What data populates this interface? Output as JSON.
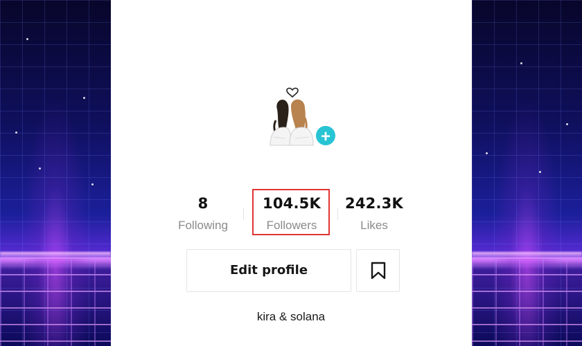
{
  "profile": {
    "avatar_icon": "two-girls-avatar-icon",
    "add_icon": "plus-icon",
    "username": "kira & solana"
  },
  "stats": {
    "following": {
      "value": "8",
      "label": "Following"
    },
    "followers": {
      "value": "104.5K",
      "label": "Followers"
    },
    "likes": {
      "value": "242.3K",
      "label": "Likes"
    }
  },
  "actions": {
    "edit_profile_label": "Edit profile",
    "bookmark_icon": "bookmark-icon"
  },
  "colors": {
    "accent_plus": "#28c4d4",
    "highlight_box": "#e03434"
  }
}
